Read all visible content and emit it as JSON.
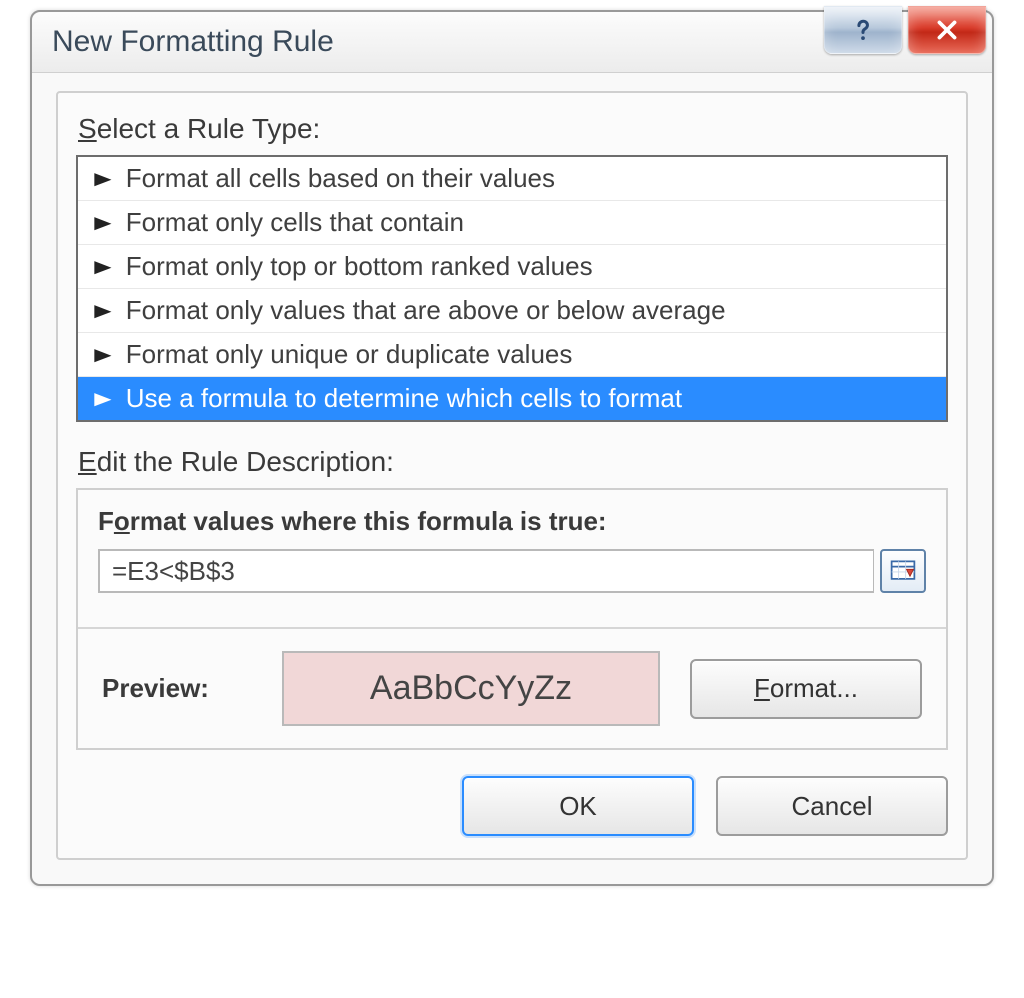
{
  "dialog": {
    "title": "New Formatting Rule"
  },
  "sections": {
    "select_label_pre": "S",
    "select_label_rest": "elect a Rule Type:",
    "edit_label_pre": "E",
    "edit_label_rest": "dit the Rule Description:"
  },
  "ruleTypes": {
    "items": [
      {
        "label": "Format all cells based on their values",
        "selected": false
      },
      {
        "label": "Format only cells that contain",
        "selected": false
      },
      {
        "label": "Format only top or bottom ranked values",
        "selected": false
      },
      {
        "label": "Format only values that are above or below average",
        "selected": false
      },
      {
        "label": "Format only unique or duplicate values",
        "selected": false
      },
      {
        "label": "Use a formula to determine which cells to format",
        "selected": true
      }
    ]
  },
  "formula": {
    "label_pre": "F",
    "label_mid": "o",
    "label_rest": "rmat values where this formula is true:",
    "value": "=E3<$B$3"
  },
  "preview": {
    "label": "Preview:",
    "sample": "AaBbCcYyZz",
    "bg": "#f1d7d7"
  },
  "buttons": {
    "format_pre": "F",
    "format_rest": "ormat...",
    "ok": "OK",
    "cancel": "Cancel"
  }
}
